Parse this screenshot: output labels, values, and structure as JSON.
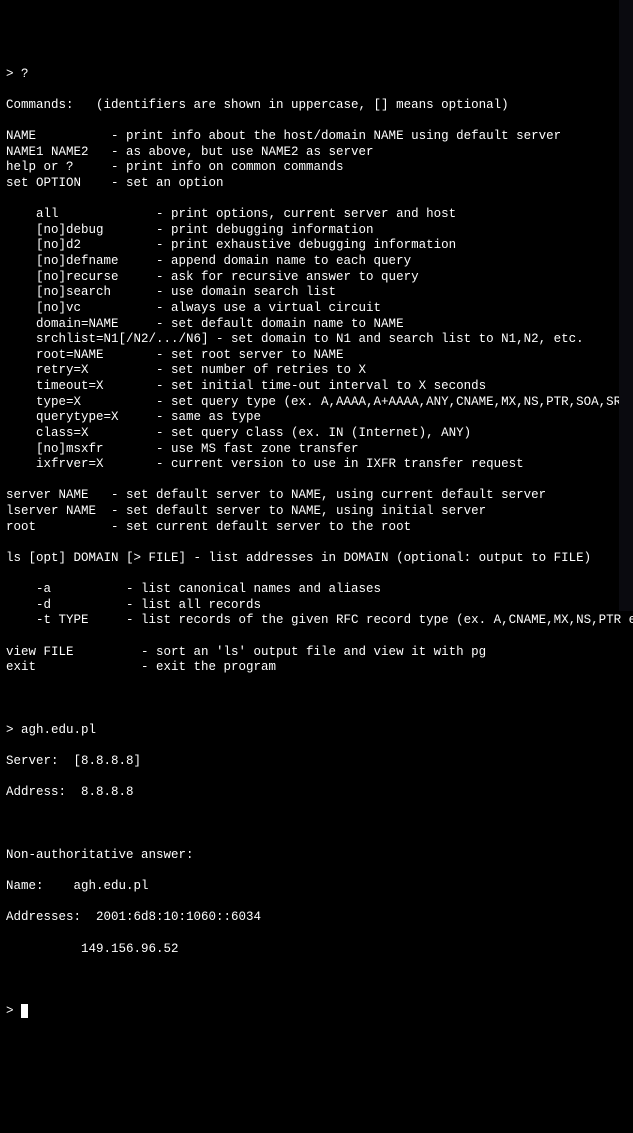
{
  "prompt1": "> ?",
  "commands_header": "Commands:   (identifiers are shown in uppercase, [] means optional)",
  "cmds": [
    [
      "NAME",
      "- print info about the host/domain NAME using default server"
    ],
    [
      "NAME1 NAME2",
      "- as above, but use NAME2 as server"
    ],
    [
      "help or ?",
      "- print info on common commands"
    ],
    [
      "set OPTION",
      "- set an option"
    ]
  ],
  "opts": [
    [
      "all",
      "- print options, current server and host"
    ],
    [
      "[no]debug",
      "- print debugging information"
    ],
    [
      "[no]d2",
      "- print exhaustive debugging information"
    ],
    [
      "[no]defname",
      "- append domain name to each query"
    ],
    [
      "[no]recurse",
      "- ask for recursive answer to query"
    ],
    [
      "[no]search",
      "- use domain search list"
    ],
    [
      "[no]vc",
      "- always use a virtual circuit"
    ],
    [
      "domain=NAME",
      "- set default domain name to NAME"
    ],
    [
      "srchlist=N1[/N2/.../N6] - set domain to N1 and search list to N1,N2, etc.",
      ""
    ],
    [
      "root=NAME",
      "- set root server to NAME"
    ],
    [
      "retry=X",
      "- set number of retries to X"
    ],
    [
      "timeout=X",
      "- set initial time-out interval to X seconds"
    ],
    [
      "type=X",
      "- set query type (ex. A,AAAA,A+AAAA,ANY,CNAME,MX,NS,PTR,SOA,SRV)"
    ],
    [
      "querytype=X",
      "- same as type"
    ],
    [
      "class=X",
      "- set query class (ex. IN (Internet), ANY)"
    ],
    [
      "[no]msxfr",
      "- use MS fast zone transfer"
    ],
    [
      "ixfrver=X",
      "- current version to use in IXFR transfer request"
    ]
  ],
  "cmds2": [
    [
      "server NAME",
      "- set default server to NAME, using current default server"
    ],
    [
      "lserver NAME",
      "- set default server to NAME, using initial server"
    ],
    [
      "root",
      "- set current default server to the root"
    ]
  ],
  "ls_header": "ls [opt] DOMAIN [> FILE] - list addresses in DOMAIN (optional: output to FILE)",
  "ls_opts": [
    [
      "-a",
      "- list canonical names and aliases"
    ],
    [
      "-d",
      "- list all records"
    ],
    [
      "-t TYPE",
      "- list records of the given RFC record type (ex. A,CNAME,MX,NS,PTR etc.)"
    ]
  ],
  "cmds3": [
    [
      "view FILE",
      "- sort an 'ls' output file and view it with pg"
    ],
    [
      "exit",
      "- exit the program"
    ]
  ],
  "query": {
    "input": "> agh.edu.pl",
    "server_label": "Server:  [8.8.8.8]",
    "address_label": "Address:  8.8.8.8",
    "nonauth": "Non-authoritative answer:",
    "name": "Name:    agh.edu.pl",
    "addresses1": "Addresses:  2001:6d8:10:1060::6034",
    "addresses2": "          149.156.96.52"
  },
  "final_prompt": "> "
}
